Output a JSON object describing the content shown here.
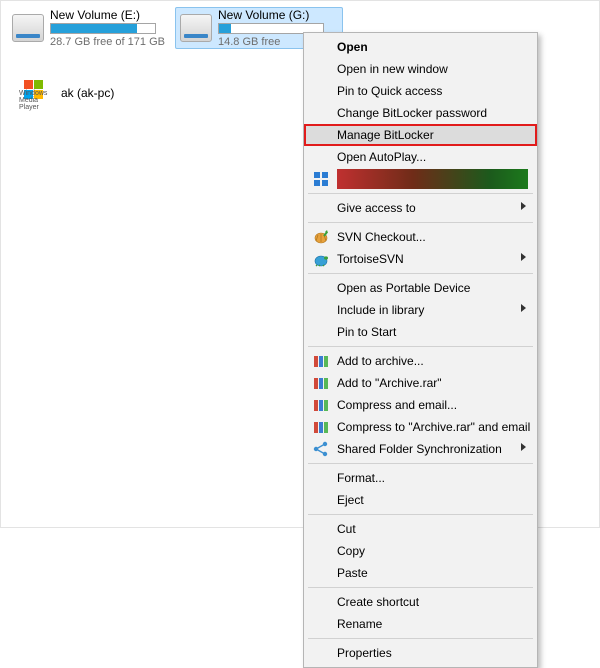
{
  "drives": [
    {
      "name": "New Volume (E:)",
      "free_text": "28.7 GB free of 171 GB",
      "fill_pct": 83
    },
    {
      "name": "New Volume (G:)",
      "free_text": "14.8 GB free",
      "fill_pct": 12
    }
  ],
  "other": {
    "label": "ak (ak-pc)",
    "icon_caption": "Windows\nMedia Player"
  },
  "menu": {
    "open": "Open",
    "open_new": "Open in new window",
    "pin_qa": "Pin to Quick access",
    "change_bl": "Change BitLocker password",
    "manage_bl": "Manage BitLocker",
    "open_ap": "Open AutoPlay...",
    "redacted": "",
    "give_access": "Give access to",
    "svn_checkout": "SVN Checkout...",
    "tortoise": "TortoiseSVN",
    "portable": "Open as Portable Device",
    "include_lib": "Include in library",
    "pin_start": "Pin to Start",
    "add_archive": "Add to archive...",
    "add_archive_rar": "Add to \"Archive.rar\"",
    "compress_email": "Compress and email...",
    "compress_rar_email": "Compress to \"Archive.rar\" and email",
    "sfs": "Shared Folder Synchronization",
    "format": "Format...",
    "eject": "Eject",
    "cut": "Cut",
    "copy": "Copy",
    "paste": "Paste",
    "create_shortcut": "Create shortcut",
    "rename": "Rename",
    "properties": "Properties"
  }
}
